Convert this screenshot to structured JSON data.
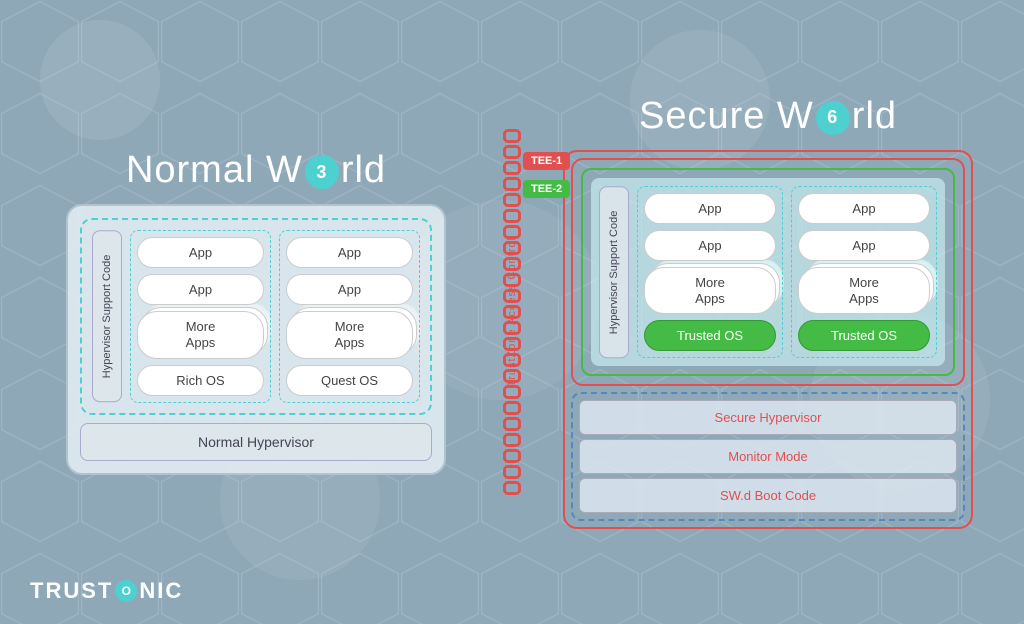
{
  "normal_world": {
    "title_pre": "Normal W",
    "title_post": "rld",
    "hypervisor_support": "Hypervisor Support Code",
    "col1": {
      "app1": "App",
      "app2": "App",
      "more_apps": "More\nApps",
      "os": "Rich OS"
    },
    "col2": {
      "app1": "App",
      "app2": "App",
      "more_apps": "More\nApps",
      "os": "Quest OS"
    },
    "hypervisor_bar": "Normal Hypervisor"
  },
  "trustzone": {
    "label": "TrustZone Access Control"
  },
  "secure_world": {
    "title_pre": "Secure W",
    "title_post": "rld",
    "hypervisor_support": "Hypervisor Support Code",
    "tee1_label": "TEE-1",
    "tee2_label": "TEE-2",
    "col1": {
      "app1": "App",
      "app2": "App",
      "more_apps": "More\nApps",
      "trusted_os": "Trusted OS"
    },
    "col2": {
      "app1": "App",
      "app2": "App",
      "more_apps": "More\nApps",
      "trusted_os": "Trusted OS"
    },
    "secure_hypervisor": "Secure Hypervisor",
    "monitor_mode": "Monitor Mode",
    "swdboot": "SW.d Boot Code"
  },
  "logo": {
    "text": "TRUST",
    "circle": "0",
    "text2": "NIC"
  }
}
